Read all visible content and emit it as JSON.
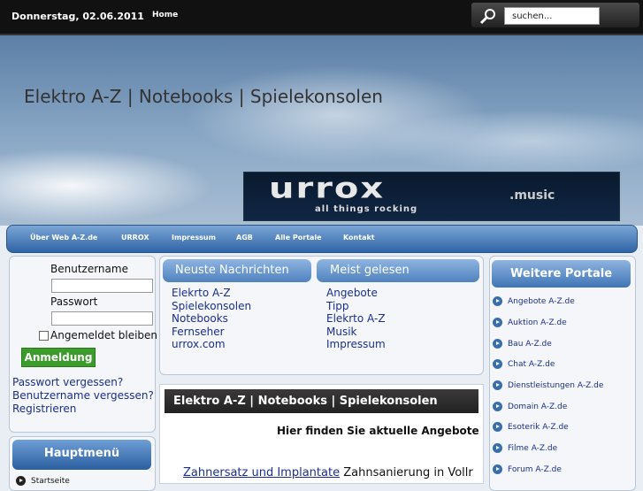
{
  "topbar": {
    "date": "Donnerstag, 02.06.2011",
    "home": "Home",
    "search_value": "suchen..."
  },
  "banner": {
    "title": "Elektro A-Z | Notebooks | Spielekonsolen",
    "logo": {
      "main": "urrox",
      "suffix": ".music",
      "tagline": "all things rocking"
    }
  },
  "nav": [
    "Über Web A-Z.de",
    "URROX",
    "Impressum",
    "AGB",
    "Alle Portale",
    "Kontakt"
  ],
  "login": {
    "username_label": "Benutzername",
    "password_label": "Passwort",
    "remember_label": "Angemeldet bleiben",
    "button": "Anmeldung",
    "links": [
      "Passwort vergessen?",
      "Benutzername vergessen?",
      "Registrieren"
    ]
  },
  "mainmenu": {
    "title": "Hauptmenü",
    "first_item": "Startseite"
  },
  "news": {
    "tab1": "Neuste Nachrichten",
    "tab2": "Meist gelesen",
    "col1": [
      "Elekrto A-Z",
      "Spielekonsolen",
      "Notebooks",
      "Fernseher",
      "urrox.com"
    ],
    "col2": [
      "Angebote",
      "Tipp",
      "Elekrto A-Z",
      "Musik",
      "Impressum"
    ]
  },
  "article": {
    "title": "Elektro A-Z | Notebooks | Spielekonsolen",
    "intro": "Hier finden Sie aktuelle Angebote d",
    "ad_link": "Zahnersatz und Implantate",
    "ad_text": "Zahnsanierung in Vollr"
  },
  "portals": {
    "title": "Weitere Portale",
    "items": [
      "Angebote A-Z.de",
      "Auktion A-Z.de",
      "Bau A-Z.de",
      "Chat A-Z.de",
      "Dienstleistungen A-Z.de",
      "Domain A-Z.de",
      "Esoterik A-Z.de",
      "Filme A-Z.de",
      "Forum A-Z.de"
    ]
  }
}
